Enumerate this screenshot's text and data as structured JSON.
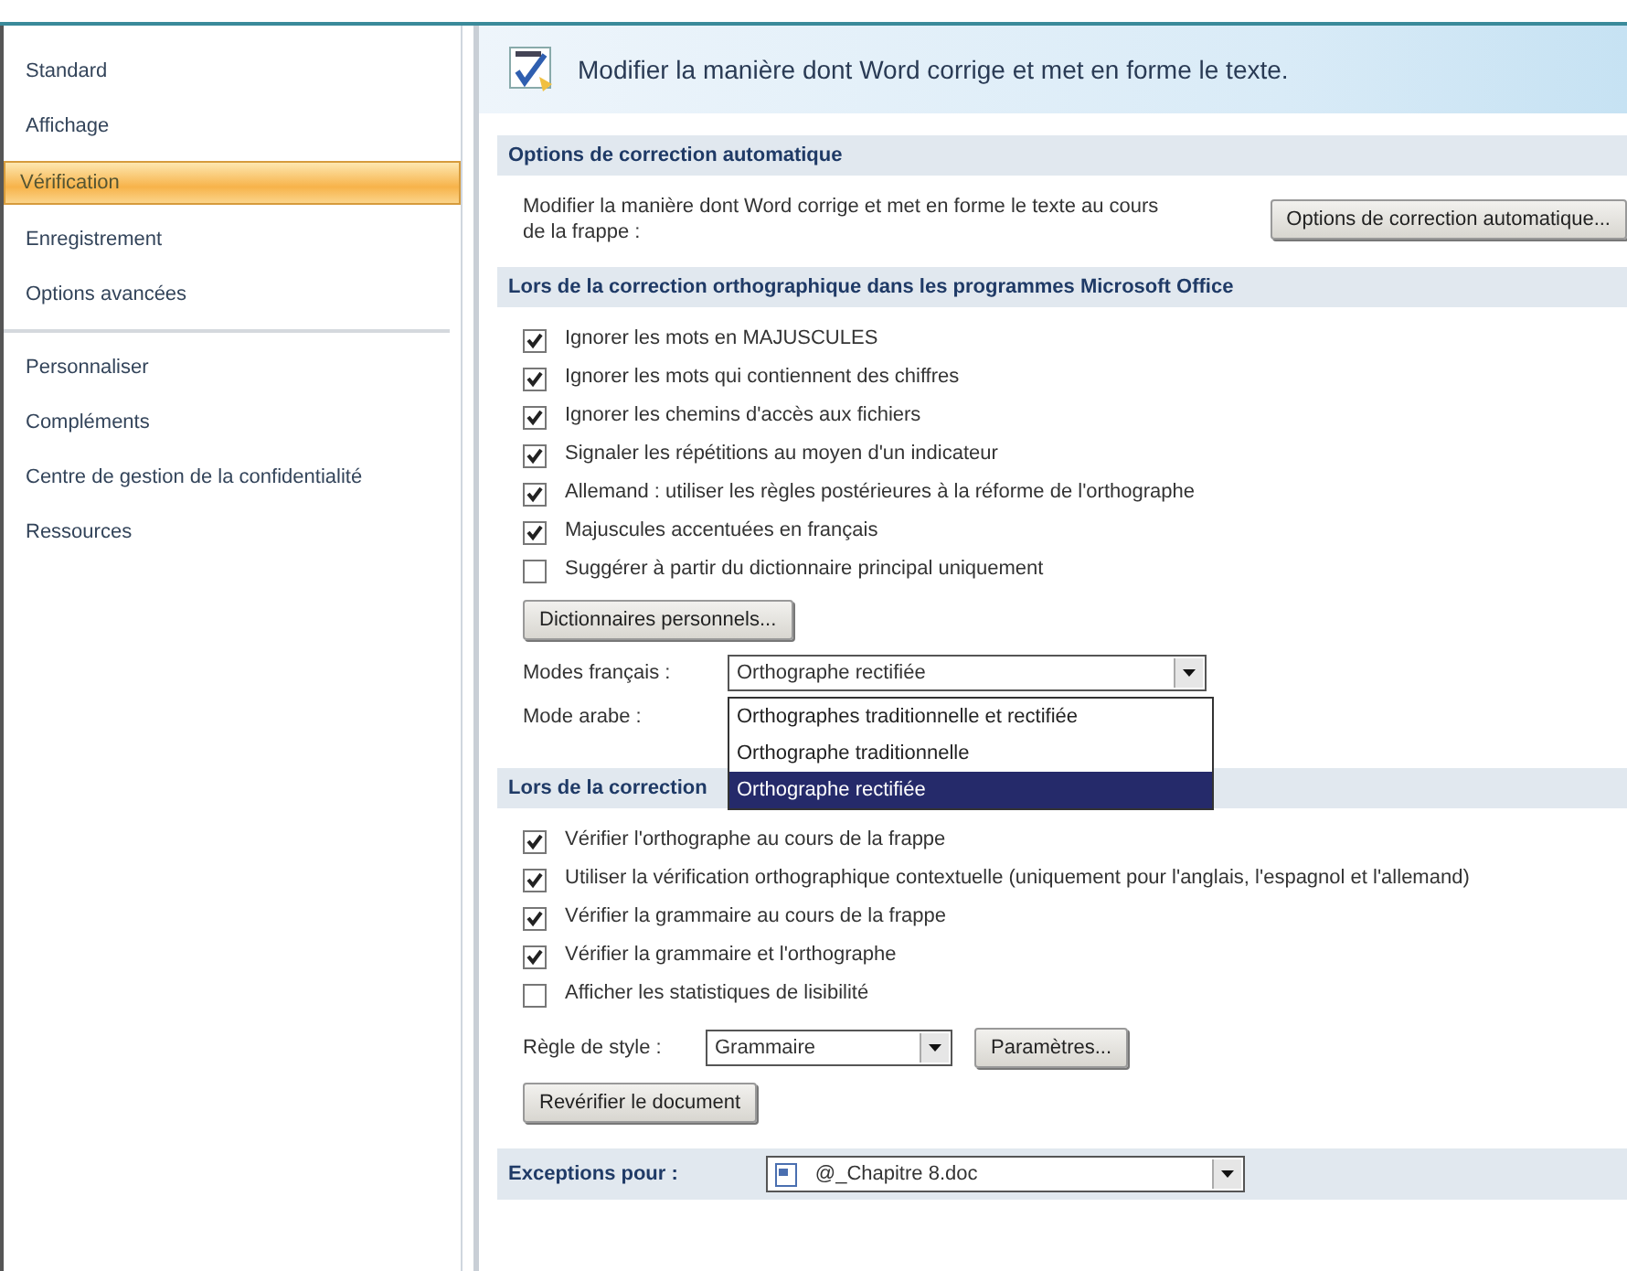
{
  "sidebar": {
    "items": [
      {
        "label": "Standard",
        "selected": false
      },
      {
        "label": "Affichage",
        "selected": false
      },
      {
        "label": "Vérification",
        "selected": true
      },
      {
        "label": "Enregistrement",
        "selected": false
      },
      {
        "label": "Options avancées",
        "selected": false
      },
      {
        "label": "Personnaliser",
        "selected": false,
        "separator_before": true
      },
      {
        "label": "Compléments",
        "selected": false
      },
      {
        "label": "Centre de gestion de la confidentialité",
        "selected": false
      },
      {
        "label": "Ressources",
        "selected": false
      }
    ]
  },
  "header": {
    "title": "Modifier la manière dont Word corrige et met en forme le texte."
  },
  "sections": [
    {
      "title": "Options de correction automatique",
      "items": [
        {
          "kind": "text_button",
          "text": "Modifier la manière dont Word corrige et met en forme le texte au cours de la frappe :",
          "button": "Options de correction automatique..."
        }
      ]
    },
    {
      "title": "Lors de la correction orthographique dans les programmes Microsoft Office",
      "items": [
        {
          "kind": "checkbox",
          "label": "Ignorer les mots en MAJUSCULES",
          "checked": true
        },
        {
          "kind": "checkbox",
          "label": "Ignorer les mots qui contiennent des chiffres",
          "checked": true
        },
        {
          "kind": "checkbox",
          "label": "Ignorer les chemins d'accès aux fichiers",
          "checked": true
        },
        {
          "kind": "checkbox",
          "label": "Signaler les répétitions au moyen d'un indicateur",
          "checked": true
        },
        {
          "kind": "checkbox",
          "label": "Allemand : utiliser les règles postérieures à la réforme de l'orthographe",
          "checked": true
        },
        {
          "kind": "checkbox",
          "label": "Majuscules accentuées en français",
          "checked": true
        },
        {
          "kind": "checkbox",
          "label": "Suggérer à partir du dictionnaire principal uniquement",
          "checked": false
        },
        {
          "kind": "button",
          "label": "Dictionnaires personnels..."
        },
        {
          "kind": "combo",
          "label": "Modes français :",
          "value": "Orthographe rectifiée",
          "open": true,
          "options": [
            {
              "label": "Orthographes traditionnelle et rectifiée",
              "selected": false
            },
            {
              "label": "Orthographe traditionnelle",
              "selected": false
            },
            {
              "label": "Orthographe rectifiée",
              "selected": true
            }
          ]
        },
        {
          "kind": "label",
          "label": "Mode arabe :"
        }
      ]
    },
    {
      "title": "Lors de la correction",
      "items": [
        {
          "kind": "checkbox",
          "label": "Vérifier l'orthographe au cours de la frappe",
          "checked": true
        },
        {
          "kind": "checkbox",
          "label": "Utiliser la vérification orthographique contextuelle (uniquement pour l'anglais, l'espagnol et l'allemand)",
          "checked": true
        },
        {
          "kind": "checkbox",
          "label": "Vérifier la grammaire au cours de la frappe",
          "checked": true
        },
        {
          "kind": "checkbox",
          "label": "Vérifier la grammaire et l'orthographe",
          "checked": true
        },
        {
          "kind": "checkbox",
          "label": "Afficher les statistiques de lisibilité",
          "checked": false
        },
        {
          "kind": "combo_button",
          "label": "Règle de style :",
          "value": "Grammaire",
          "button": "Paramètres..."
        },
        {
          "kind": "button",
          "label": "Revérifier le document"
        }
      ]
    }
  ],
  "exceptions": {
    "label": "Exceptions pour :",
    "value": "@_Chapitre 8.doc"
  }
}
